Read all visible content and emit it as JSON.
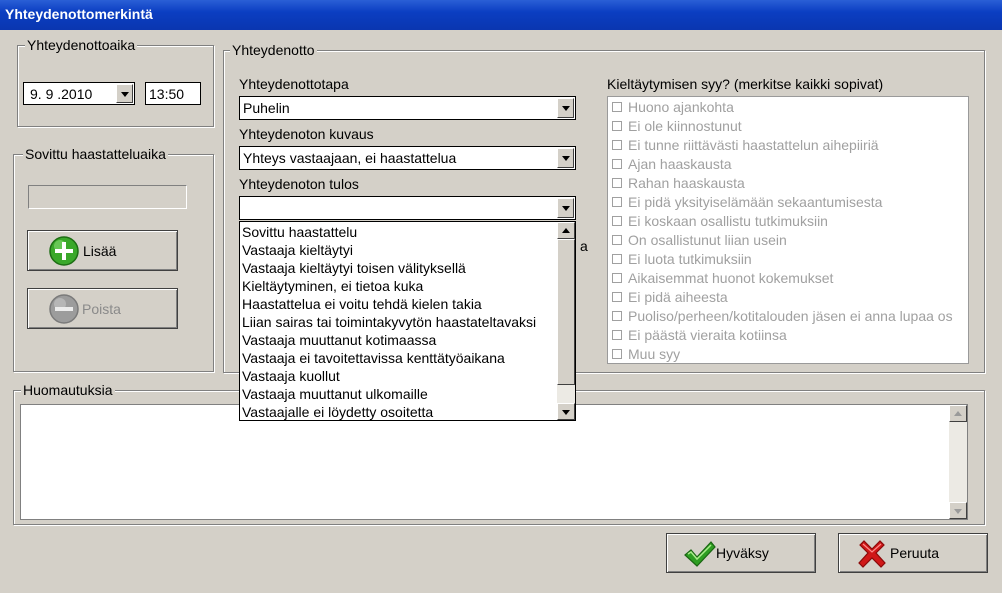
{
  "window": {
    "title": "Yhteydenottomerkintä"
  },
  "contact_time": {
    "group_label": "Yhteydenottoaika",
    "date": "9. 9 .2010",
    "time": "13:50"
  },
  "appointment": {
    "group_label": "Sovittu haastatteluaika",
    "value": "",
    "add_label": "Lisää",
    "remove_label": "Poista"
  },
  "contact": {
    "group_label": "Yhteydenotto",
    "method_label": "Yhteydenottotapa",
    "method_value": "Puhelin",
    "description_label": "Yhteydenoton kuvaus",
    "description_value": "Yhteys vastaajaan, ei haastattelua",
    "result_label": "Yhteydenoton tulos",
    "result_value": "",
    "hidden_text_fragment": "a",
    "result_options": [
      "Sovittu haastattelu",
      "Vastaaja kieltäytyi",
      "Vastaaja kieltäytyi toisen välityksellä",
      "Kieltäytyminen, ei tietoa kuka",
      "Haastattelua ei voitu tehdä kielen takia",
      "Liian sairas tai toimintakyvytön haastateltavaksi",
      "Vastaaja muuttanut kotimaassa",
      "Vastaaja ei tavoitettavissa kenttätyöaikana",
      "Vastaaja kuollut",
      "Vastaaja muuttanut ulkomaille",
      "Vastaajalle ei löydetty osoitetta"
    ]
  },
  "refusal": {
    "label": "Kieltäytymisen syy? (merkitse kaikki sopivat)",
    "reasons": [
      "Huono ajankohta",
      "Ei ole kiinnostunut",
      "Ei tunne riittävästi haastattelun aihepiiriä",
      "Ajan haaskausta",
      "Rahan haaskausta",
      "Ei pidä yksityiselämään sekaantumisesta",
      "Ei koskaan osallistu tutkimuksiin",
      "On osallistunut liian usein",
      "Ei luota tutkimuksiin",
      "Aikaisemmat huonot kokemukset",
      "Ei pidä aiheesta",
      "Puoliso/perheen/kotitalouden jäsen ei anna lupaa os",
      "Ei päästä vieraita kotiinsa",
      "Muu syy"
    ]
  },
  "notes": {
    "group_label": "Huomautuksia",
    "value": ""
  },
  "footer": {
    "accept_label": "Hyväksy",
    "cancel_label": "Peruuta"
  },
  "colors": {
    "title_bar": "#0a36b0",
    "accept_green": "#2e9e22",
    "cancel_red": "#d01818"
  }
}
